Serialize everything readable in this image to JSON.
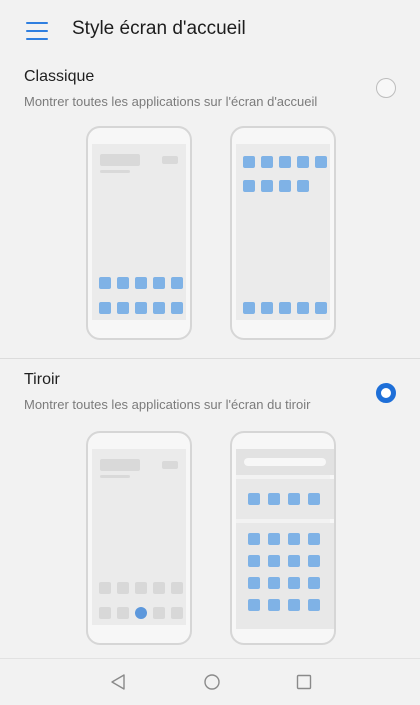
{
  "header": {
    "title": "Style écran d'accueil",
    "menu_icon": "hamburger-menu-icon",
    "accent": "#2f7fe0"
  },
  "options": [
    {
      "title": "Classique",
      "description": "Montrer toutes les applications sur l'écran d'accueil",
      "selected": false
    },
    {
      "title": "Tiroir",
      "description": "Montrer toutes les applications sur l'écran du tiroir",
      "selected": true
    }
  ],
  "colors": {
    "app_tile": "#7fb2e6",
    "radio_selected": "#1e6fd8",
    "background": "#f2f2f2"
  },
  "navbar": {
    "icons": [
      "back-triangle-icon",
      "home-circle-icon",
      "recents-square-icon"
    ]
  }
}
